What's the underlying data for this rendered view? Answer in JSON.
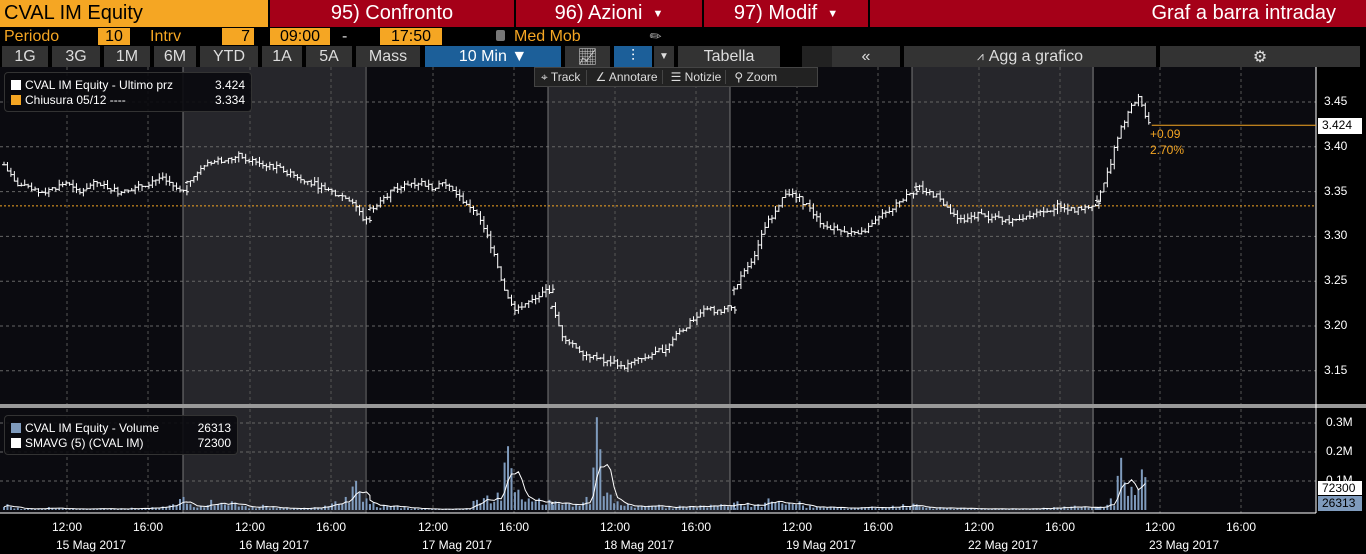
{
  "header": {
    "ticker": "CVAL IM Equity",
    "btn95": "95) Confronto",
    "btn96": "96) Azioni",
    "btn97": "97) Modif",
    "title": "Graf a barra intraday"
  },
  "params": {
    "periodo_label": "Periodo",
    "periodo": "10",
    "intrv_label": "Intrv",
    "intrv": "7",
    "start": "09:00",
    "dash": "-",
    "end": "17:50",
    "med_mob": "Med Mob"
  },
  "toolbar": {
    "ranges": [
      "1G",
      "3G",
      "1M",
      "6M",
      "YTD",
      "1A",
      "5A",
      "Mass"
    ],
    "interval": "10 Min ▼",
    "tabella": "Tabella",
    "collapse": "«",
    "agg": "Agg a grafico"
  },
  "subtools": {
    "track": "Track",
    "annotare": "Annotare",
    "notizie": "Notizie",
    "zoom": "Zoom"
  },
  "legend_price": {
    "l1": "CVAL IM Equity - Ultimo prz",
    "v1": "3.424",
    "l2": "Chiusura 05/12 ----",
    "v2": "3.334"
  },
  "legend_vol": {
    "l1": "CVAL IM Equity - Volume",
    "v1": "26313",
    "l2": "SMAVG (5) (CVAL IM)",
    "v2": "72300"
  },
  "annot": {
    "change": "+0.09",
    "pct": "2.70%",
    "last": "3.424",
    "vol_last": "26313",
    "sma_last": "72300"
  },
  "colors": {
    "accent": "#f5a623",
    "red": "#a50018",
    "volume": "#7f9bbd"
  },
  "chart_data": {
    "type": "bar",
    "price_axis": {
      "ticks": [
        "3.45",
        "3.40",
        "3.35",
        "3.30",
        "3.25",
        "3.20",
        "3.15"
      ],
      "range": [
        3.12,
        3.49
      ]
    },
    "volume_axis": {
      "ticks": [
        "0.3M",
        "0.2M",
        "0.1M",
        "0"
      ],
      "range": [
        0,
        350000
      ]
    },
    "previous_close": 3.334,
    "days": [
      {
        "date": "15 Mag 2017",
        "closes": [
          3.38,
          3.36,
          3.355,
          3.35,
          3.35,
          3.355,
          3.36,
          3.35,
          3.355,
          3.36,
          3.355,
          3.35,
          3.35,
          3.355,
          3.36,
          3.365,
          3.36,
          3.35
        ],
        "vol": [
          20,
          8,
          6,
          5,
          10,
          6,
          5,
          4,
          5,
          6,
          5,
          6,
          8,
          7,
          10,
          12,
          20,
          45
        ]
      },
      {
        "date": "16 Mag 2017",
        "closes": [
          3.36,
          3.37,
          3.38,
          3.385,
          3.385,
          3.39,
          3.385,
          3.38,
          3.38,
          3.375,
          3.37,
          3.365,
          3.36,
          3.355,
          3.35,
          3.345,
          3.34,
          3.32
        ],
        "vol": [
          20,
          15,
          35,
          25,
          30,
          15,
          12,
          18,
          10,
          8,
          6,
          8,
          10,
          15,
          30,
          45,
          100,
          40
        ]
      },
      {
        "date": "17 Mag 2017",
        "closes": [
          3.33,
          3.34,
          3.35,
          3.355,
          3.36,
          3.36,
          3.355,
          3.36,
          3.35,
          3.34,
          3.33,
          3.31,
          3.28,
          3.24,
          3.22,
          3.225,
          3.23,
          3.24
        ],
        "vol": [
          25,
          18,
          15,
          12,
          8,
          5,
          4,
          4,
          5,
          6,
          35,
          50,
          60,
          220,
          70,
          40,
          40,
          35
        ]
      },
      {
        "date": "18 Mag 2017",
        "closes": [
          3.22,
          3.19,
          3.18,
          3.17,
          3.165,
          3.16,
          3.16,
          3.155,
          3.16,
          3.165,
          3.17,
          3.175,
          3.19,
          3.2,
          3.21,
          3.22,
          3.215,
          3.22
        ],
        "vol": [
          30,
          25,
          20,
          45,
          320,
          60,
          30,
          20,
          15,
          15,
          18,
          12,
          15,
          14,
          16,
          18,
          20,
          15
        ]
      },
      {
        "date": "19 Mag 2017",
        "closes": [
          3.24,
          3.26,
          3.28,
          3.31,
          3.33,
          3.35,
          3.345,
          3.335,
          3.32,
          3.31,
          3.31,
          3.305,
          3.3,
          3.31,
          3.32,
          3.33,
          3.34,
          3.35
        ],
        "vol": [
          30,
          25,
          20,
          40,
          30,
          25,
          30,
          15,
          12,
          12,
          10,
          8,
          10,
          12,
          10,
          15,
          20,
          22
        ]
      },
      {
        "date": "22 Mag 2017",
        "closes": [
          3.355,
          3.35,
          3.345,
          3.33,
          3.32,
          3.32,
          3.325,
          3.32,
          3.32,
          3.315,
          3.32,
          3.325,
          3.33,
          3.33,
          3.335,
          3.33,
          3.33,
          3.335
        ],
        "vol": [
          12,
          10,
          10,
          8,
          8,
          6,
          6,
          5,
          5,
          6,
          5,
          6,
          8,
          10,
          12,
          15,
          12,
          10
        ]
      },
      {
        "date": "23 Mag 2017",
        "closes": [
          3.34,
          3.37,
          3.41,
          3.44,
          3.455,
          3.424
        ],
        "vol": [
          12,
          40,
          180,
          80,
          140,
          26.313
        ]
      }
    ],
    "x_ticks": [
      "12:00",
      "16:00"
    ]
  }
}
